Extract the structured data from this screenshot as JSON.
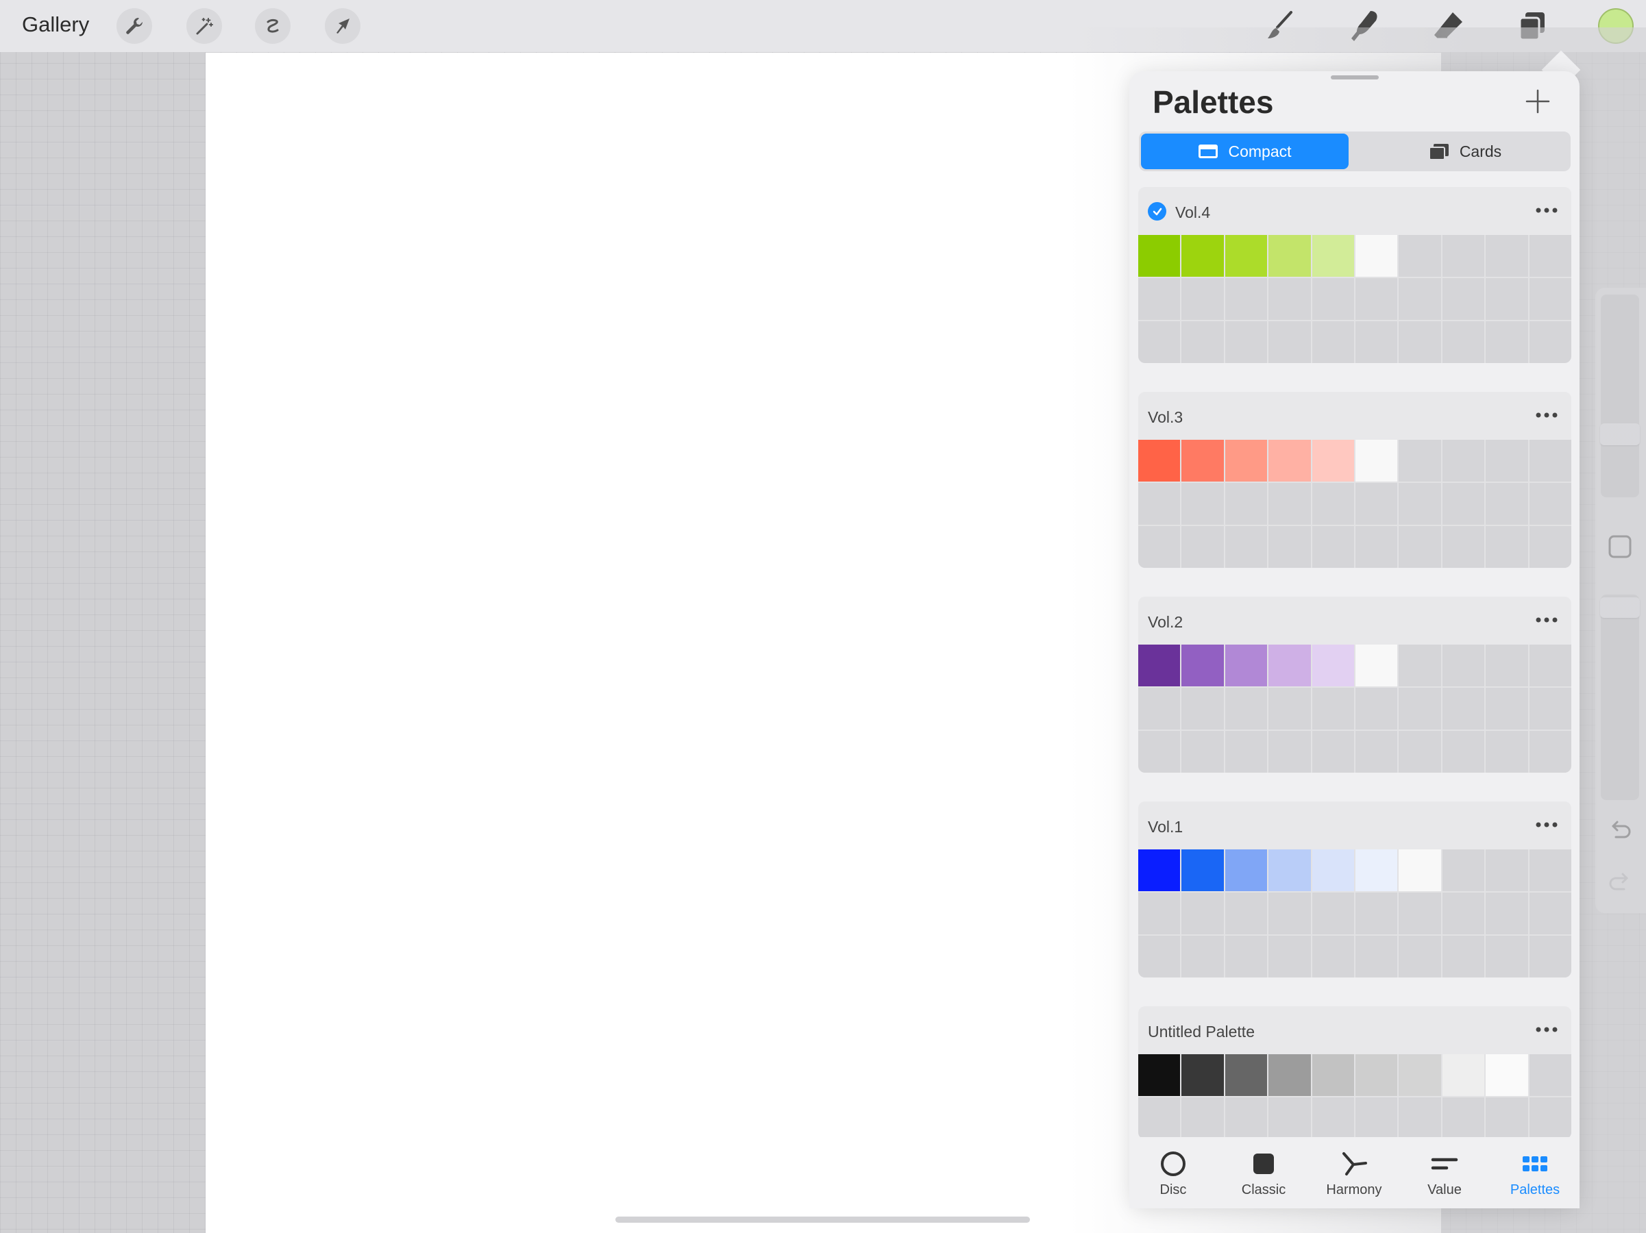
{
  "toolbar": {
    "gallery": "Gallery",
    "current_color": "#c7e98f"
  },
  "panel": {
    "title": "Palettes",
    "views": {
      "compact": "Compact",
      "cards": "Cards",
      "active": "Compact"
    },
    "palettes": [
      {
        "name": "Vol.4",
        "default": true,
        "swatches": [
          "#8ccc00",
          "#9dd40e",
          "#acdc2a",
          "#c3e46a",
          "#d2ec98",
          "#f8f8f8"
        ]
      },
      {
        "name": "Vol.3",
        "default": false,
        "swatches": [
          "#ff6347",
          "#ff7a63",
          "#ff9a86",
          "#ffb1a4",
          "#ffc8c0",
          "#f8f8f8"
        ]
      },
      {
        "name": "Vol.2",
        "default": false,
        "swatches": [
          "#6a329a",
          "#9260c2",
          "#b188d6",
          "#cfb0e6",
          "#e2d0f2",
          "#f8f8f8"
        ]
      },
      {
        "name": "Vol.1",
        "default": false,
        "swatches": [
          "#0a1eff",
          "#1a66f5",
          "#80a6f6",
          "#b9cdf8",
          "#d9e3fa",
          "#eaf0fc",
          "#f8f8f8"
        ]
      },
      {
        "name": "Untitled Palette",
        "default": false,
        "swatches": [
          "#111111",
          "#383838",
          "#666666",
          "#9c9c9c",
          "#c2c2c2",
          "#cecece",
          "#d4d4d4",
          "#eeeeee",
          "#fafafa"
        ]
      }
    ]
  },
  "tabs": {
    "disc": "Disc",
    "classic": "Classic",
    "harmony": "Harmony",
    "value": "Value",
    "palettes": "Palettes",
    "active": "Palettes"
  }
}
